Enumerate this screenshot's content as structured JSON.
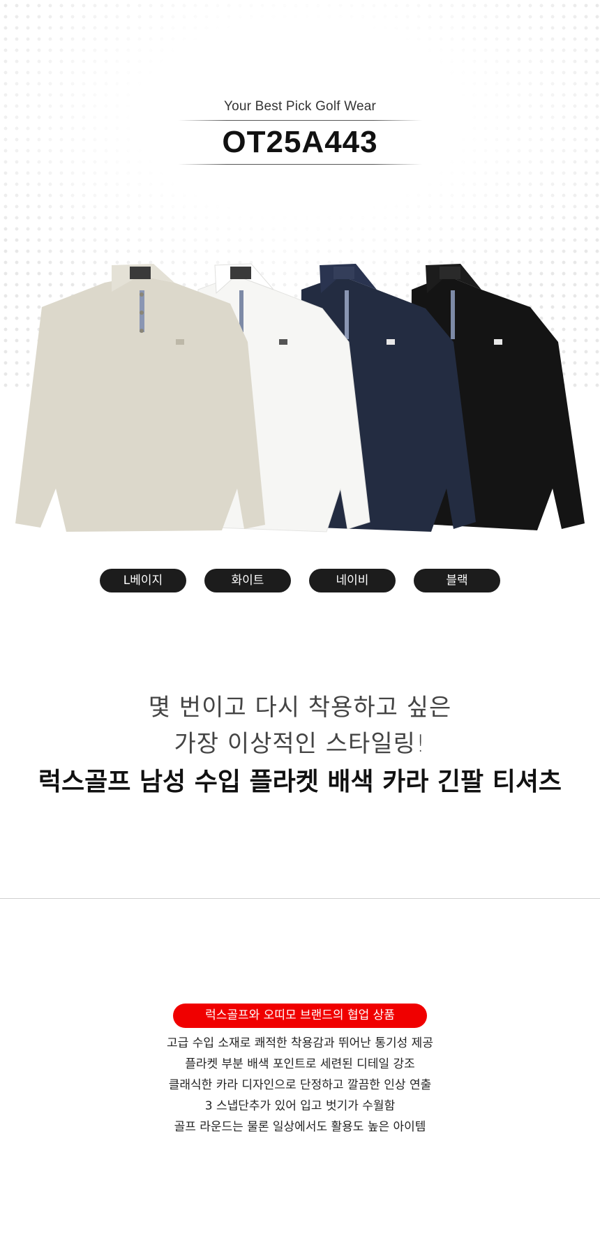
{
  "header": {
    "tagline": "Your Best Pick Golf Wear",
    "product_code": "OT25A443"
  },
  "colors": [
    {
      "label": "L베이지",
      "hex": "#dcd8cb"
    },
    {
      "label": "화이트",
      "hex": "#f6f6f4"
    },
    {
      "label": "네이비",
      "hex": "#232c41"
    },
    {
      "label": "블랙",
      "hex": "#141414"
    }
  ],
  "intro": {
    "line1": "몇 번이고 다시 착용하고 싶은",
    "line2": "가장 이상적인 스타일링!",
    "title": "럭스골프 남성 수입 플라켓 배색 카라 긴팔 티셔츠"
  },
  "collab_badge": "럭스골프와 오띠모 브랜드의 협업 상품",
  "features": [
    "고급 수입 소재로 쾌적한 착용감과 뛰어난 통기성 제공",
    "플라켓 부분 배색 포인트로 세련된 디테일 강조",
    "클래식한 카라 디자인으로 단정하고 깔끔한 인상 연출",
    "3 스냅단추가 있어 입고 벗기가 수월함",
    "골프 라운드는 물론 일상에서도 활용도 높은 아이템"
  ]
}
